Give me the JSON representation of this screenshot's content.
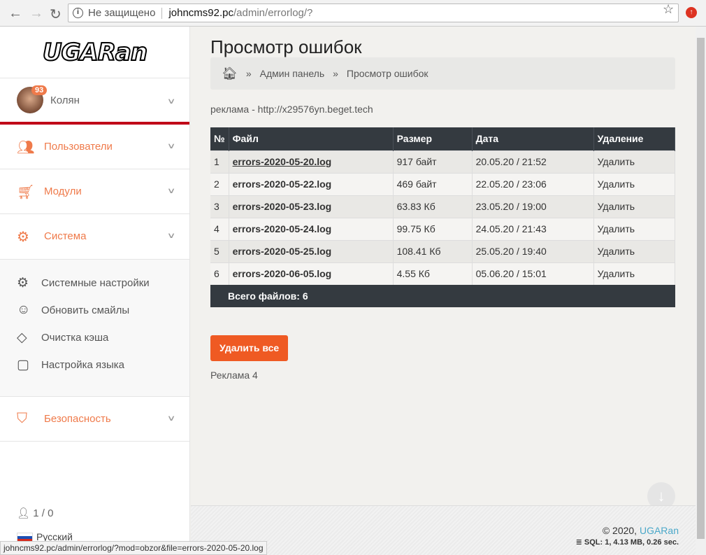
{
  "browser": {
    "security": "Не защищено",
    "host": "johncms92.pc",
    "path": "/admin/errorlog/?",
    "status_url": "johncms92.pc/admin/errorlog/?mod=obzor&file=errors-2020-05-20.log"
  },
  "sidebar": {
    "logo": "UGARan",
    "user": {
      "name": "Колян",
      "badge": "93"
    },
    "menu": [
      {
        "label": "Пользователи",
        "icon": "users-icon"
      },
      {
        "label": "Модули",
        "icon": "cart-icon"
      },
      {
        "label": "Система",
        "icon": "gear-icon"
      }
    ],
    "submenu": [
      {
        "label": "Системные настройки",
        "icon": "gear-icon"
      },
      {
        "label": "Обновить смайлы",
        "icon": "smile-icon"
      },
      {
        "label": "Очистка кэша",
        "icon": "eraser-icon"
      },
      {
        "label": "Настройка языка",
        "icon": "chat-icon"
      }
    ],
    "security": "Безопасность",
    "online": "1 / 0",
    "language": "Русский"
  },
  "main": {
    "title": "Просмотр ошибок",
    "breadcrumb": [
      "Админ панель",
      "Просмотр ошибок"
    ],
    "ad_top": "реклама - http://x29576yn.beget.tech",
    "table": {
      "headers": [
        "№",
        "Файл",
        "Размер",
        "Дата",
        "Удаление"
      ],
      "rows": [
        [
          "1",
          "errors-2020-05-20.log",
          "917 байт",
          "20.05.20 / 21:52",
          "Удалить"
        ],
        [
          "2",
          "errors-2020-05-22.log",
          "469 байт",
          "22.05.20 / 23:06",
          "Удалить"
        ],
        [
          "3",
          "errors-2020-05-23.log",
          "63.83 Кб",
          "23.05.20 / 19:00",
          "Удалить"
        ],
        [
          "4",
          "errors-2020-05-24.log",
          "99.75 Кб",
          "24.05.20 / 21:43",
          "Удалить"
        ],
        [
          "5",
          "errors-2020-05-25.log",
          "108.41 Кб",
          "25.05.20 / 19:40",
          "Удалить"
        ],
        [
          "6",
          "errors-2020-06-05.log",
          "4.55 Кб",
          "05.06.20 / 15:01",
          "Удалить"
        ]
      ],
      "total": "Всего файлов: 6"
    },
    "delete_all": "Удалить все",
    "ad_bottom": "Реклама 4"
  },
  "footer": {
    "copyright": "© 2020, ",
    "brand": "UGARan",
    "sql": "SQL: 1, 4.13 MB, 0.26 sec."
  }
}
